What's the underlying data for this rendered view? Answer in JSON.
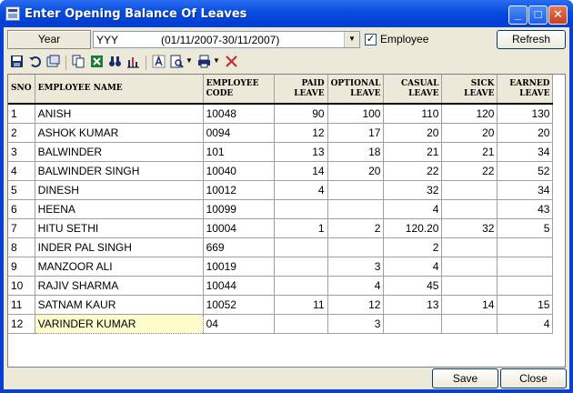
{
  "window": {
    "title": "Enter Opening Balance Of Leaves",
    "minimize_glyph": "_",
    "maximize_glyph": "□",
    "close_glyph": "✕"
  },
  "filter": {
    "year_label": "Year",
    "year_value": "YYY",
    "year_range": "(01/11/2007-30/11/2007)",
    "employee_checked": "✓",
    "employee_label": "Employee",
    "refresh_label": "Refresh"
  },
  "toolbar": {
    "icons": [
      "save-icon",
      "undo-icon",
      "print-preview-icon",
      "copy-icon",
      "excel-icon",
      "find-icon",
      "chart-icon",
      "font-icon",
      "preview-icon",
      "printer-icon",
      "delete-icon"
    ]
  },
  "grid": {
    "columns": [
      "SNO",
      "EMPLOYEE NAME",
      "EMPLOYEE CODE",
      "PAID LEAVE",
      "OPTIONAL LEAVE",
      "CASUAL LEAVE",
      "SICK LEAVE",
      "EARNED LEAVE"
    ],
    "rows": [
      [
        "1",
        "ANISH",
        "10048",
        "90",
        "100",
        "110",
        "120",
        "130"
      ],
      [
        "2",
        "ASHOK KUMAR",
        "0094",
        "12",
        "17",
        "20",
        "20",
        "20"
      ],
      [
        "3",
        "BALWINDER",
        "101",
        "13",
        "18",
        "21",
        "21",
        "34"
      ],
      [
        "4",
        "BALWINDER SINGH",
        "10040",
        "14",
        "20",
        "22",
        "22",
        "52"
      ],
      [
        "5",
        "DINESH",
        "10012",
        "4",
        "",
        "32",
        "",
        "34"
      ],
      [
        "6",
        "HEENA",
        "10099",
        "",
        "",
        "4",
        "",
        "43"
      ],
      [
        "7",
        "HITU SETHI",
        "10004",
        "1",
        "2",
        "120.20",
        "32",
        "5"
      ],
      [
        "8",
        "INDER PAL SINGH",
        "669",
        "",
        "",
        "2",
        "",
        ""
      ],
      [
        "9",
        "MANZOOR ALI",
        "10019",
        "",
        "3",
        "4",
        "",
        ""
      ],
      [
        "10",
        "RAJIV SHARMA",
        "10044",
        "",
        "4",
        "45",
        "",
        ""
      ],
      [
        "11",
        "SATNAM KAUR",
        "10052",
        "11",
        "12",
        "13",
        "14",
        "15"
      ],
      [
        "12",
        "VARINDER KUMAR",
        "04",
        "",
        "3",
        "",
        "",
        "4"
      ]
    ]
  },
  "footer": {
    "save_label": "Save",
    "close_label": "Close"
  }
}
